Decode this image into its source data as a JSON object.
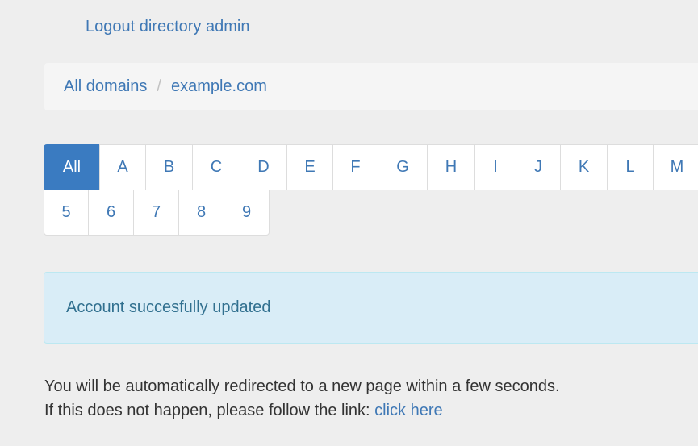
{
  "header": {
    "logout_label": "Logout directory admin"
  },
  "breadcrumb": {
    "items": [
      {
        "label": "All domains"
      },
      {
        "label": "example.com"
      }
    ],
    "separator": "/"
  },
  "pager": {
    "row1": [
      "All",
      "A",
      "B",
      "C",
      "D",
      "E",
      "F",
      "G",
      "H",
      "I",
      "J",
      "K",
      "L",
      "M"
    ],
    "row2": [
      "5",
      "6",
      "7",
      "8",
      "9"
    ],
    "active": "All"
  },
  "alert": {
    "text": "Account succesfully updated"
  },
  "message": {
    "line1": "You will be automatically redirected to a new page within a few seconds.",
    "line2_prefix": "If this does not happen, please follow the link:",
    "link_label": "click here"
  },
  "colors": {
    "accent": "#3a7bc1",
    "link": "#3f78b5",
    "alert_bg": "#d9edf7",
    "alert_text": "#31708f"
  }
}
